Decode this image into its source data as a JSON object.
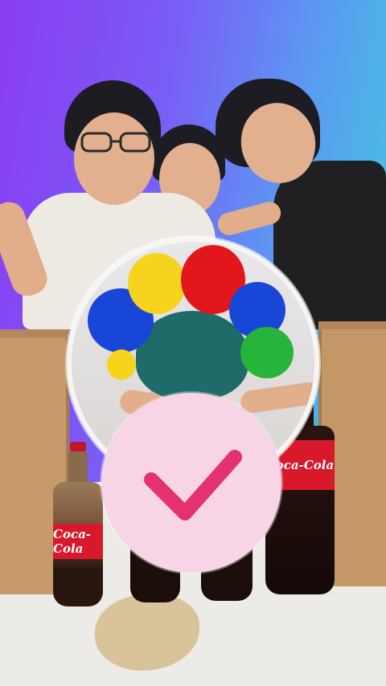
{
  "colors": {
    "check_mark": "#e3326e",
    "badge_bg": "#f7d5e6",
    "balloon_red": "#e3161b",
    "balloon_blue": "#1846d6",
    "balloon_yellow": "#f6d31c",
    "balloon_green": "#27b43a",
    "hair_teal": "#1e6b69",
    "bottle_label": "#d8182b"
  },
  "bottles": {
    "left_label": "Coca-Cola",
    "right_label": "Coca-Cola"
  },
  "icons": {
    "result": "check-icon"
  }
}
